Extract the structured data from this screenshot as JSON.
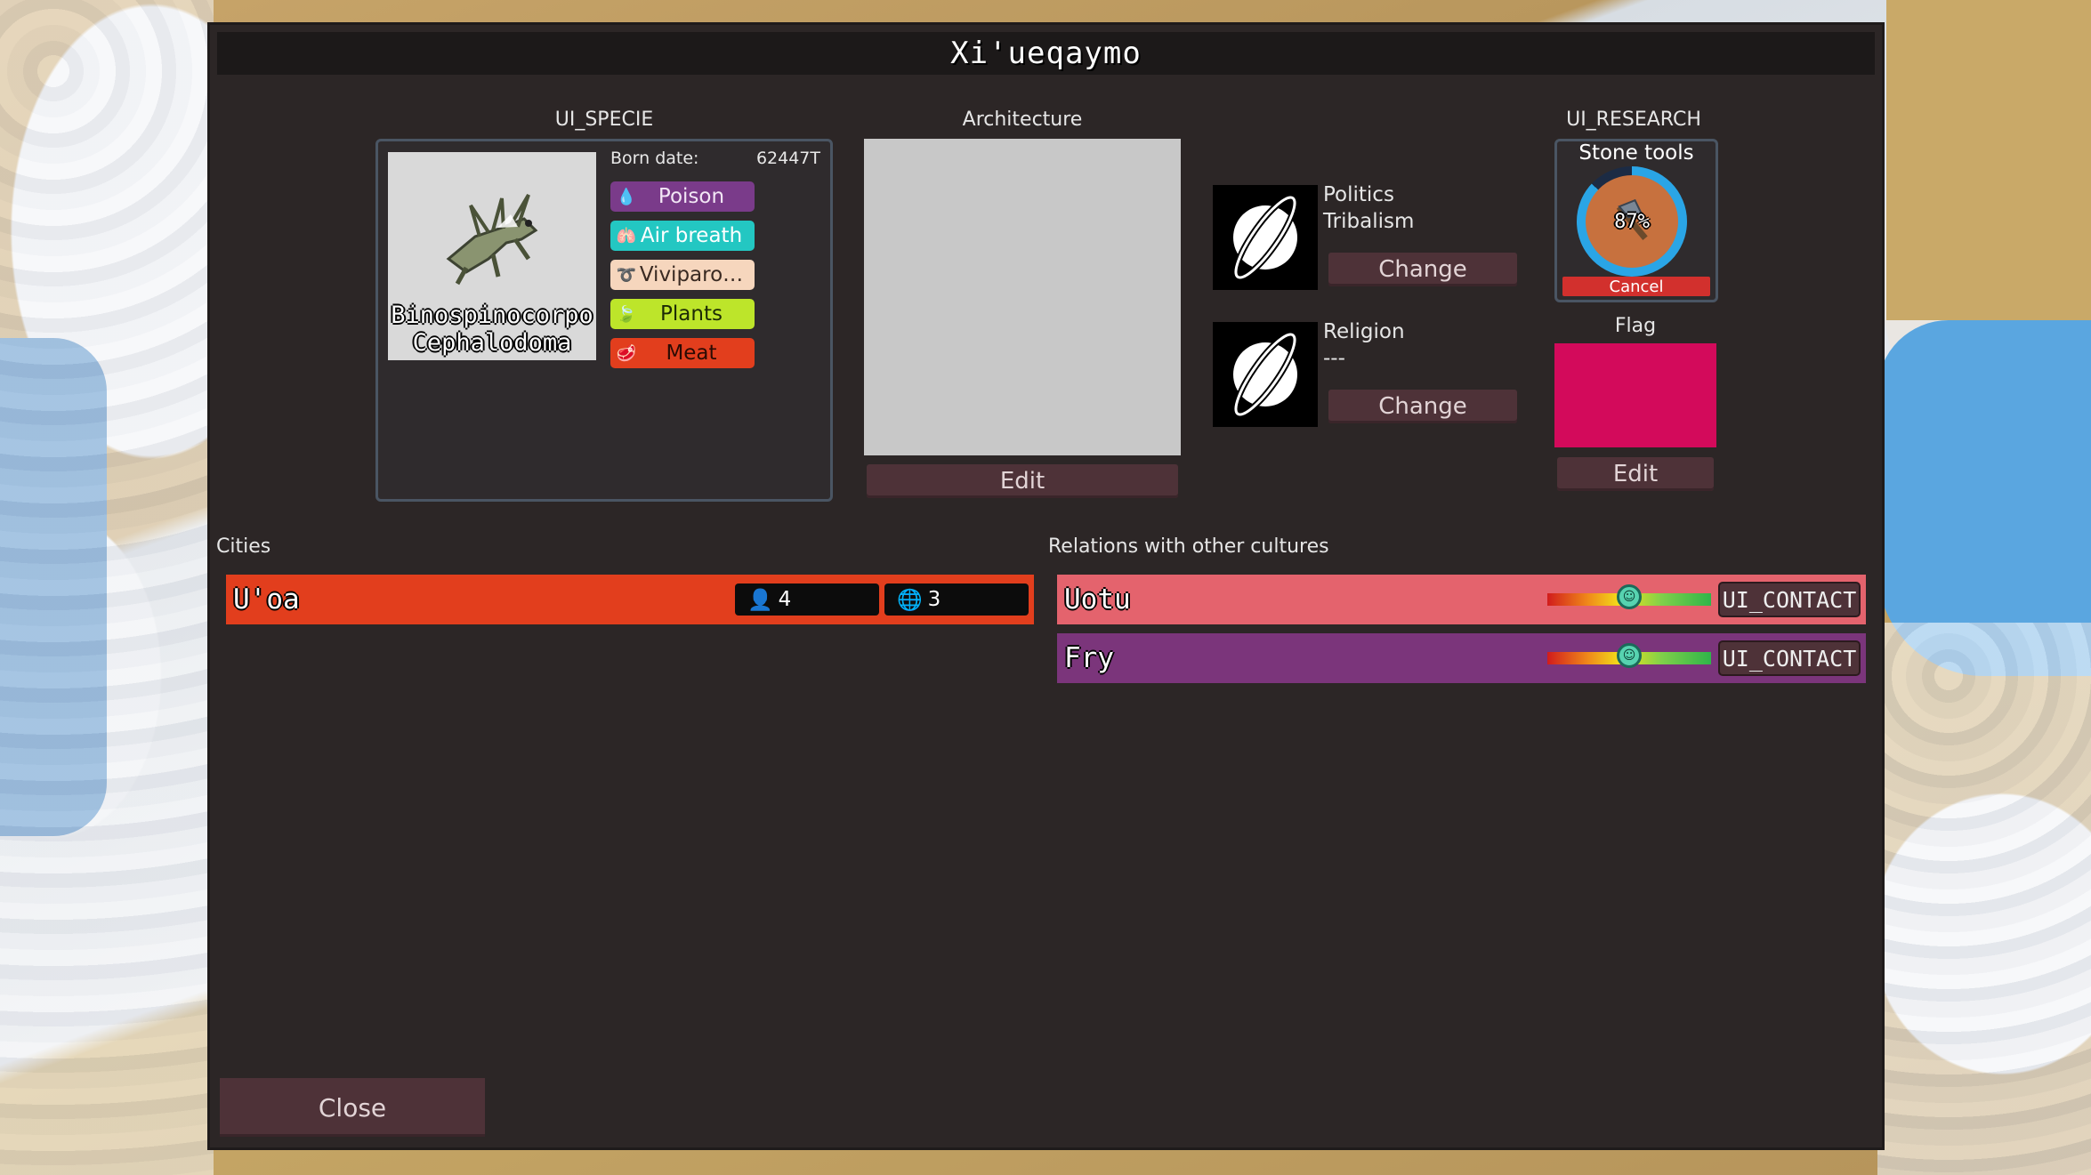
{
  "window": {
    "title": "Xi'ueqaymo"
  },
  "specie": {
    "section_label": "UI_SPECIE",
    "born_label": "Born date:",
    "born_value": "62447T",
    "name_line1": "Binospinocorpo",
    "name_line2": "Cephalodoma",
    "traits": [
      {
        "label": "Poison",
        "bg": "#7a3b8a",
        "fg": "#f2e6f5",
        "icon": "drop-icon",
        "glyph": "💧"
      },
      {
        "label": "Air breath",
        "bg": "#23c7c2",
        "fg": "#ffffff",
        "icon": "lungs-icon",
        "glyph": "🫁"
      },
      {
        "label": "Viviparo…",
        "bg": "#f6d6bd",
        "fg": "#3a2a22",
        "icon": "birth-icon",
        "glyph": "➰"
      },
      {
        "label": "Plants",
        "bg": "#bde52a",
        "fg": "#1c2a06",
        "icon": "leaf-icon",
        "glyph": "🍃"
      },
      {
        "label": "Meat",
        "bg": "#e23e1d",
        "fg": "#2a0b04",
        "icon": "meat-icon",
        "glyph": "🥩"
      }
    ]
  },
  "architecture": {
    "section_label": "Architecture",
    "edit_label": "Edit"
  },
  "politics": {
    "label": "Politics",
    "value": "Tribalism",
    "change_label": "Change",
    "icon": "planet-icon"
  },
  "religion": {
    "label": "Religion",
    "value": "---",
    "change_label": "Change",
    "icon": "planet-icon"
  },
  "research": {
    "section_label": "UI_RESEARCH",
    "current": "Stone tools",
    "progress_text": "87%",
    "progress": 0.87,
    "cancel_label": "Cancel",
    "icon": "axe-icon"
  },
  "flag": {
    "section_label": "Flag",
    "edit_label": "Edit",
    "color": "#d30a5b"
  },
  "cities": {
    "section_label": "Cities",
    "items": [
      {
        "name": "U'oa",
        "population": "4",
        "tiles": "3",
        "color": "#e23e1d"
      }
    ]
  },
  "relations": {
    "section_label": "Relations with other cultures",
    "items": [
      {
        "name": "Uotu",
        "color": "#e4636d",
        "attitude": 0.5,
        "contact_label": "UI_CONTACT"
      },
      {
        "name": "Fry",
        "color": "#7b357b",
        "attitude": 0.5,
        "contact_label": "UI_CONTACT"
      }
    ]
  },
  "footer": {
    "close_label": "Close"
  }
}
